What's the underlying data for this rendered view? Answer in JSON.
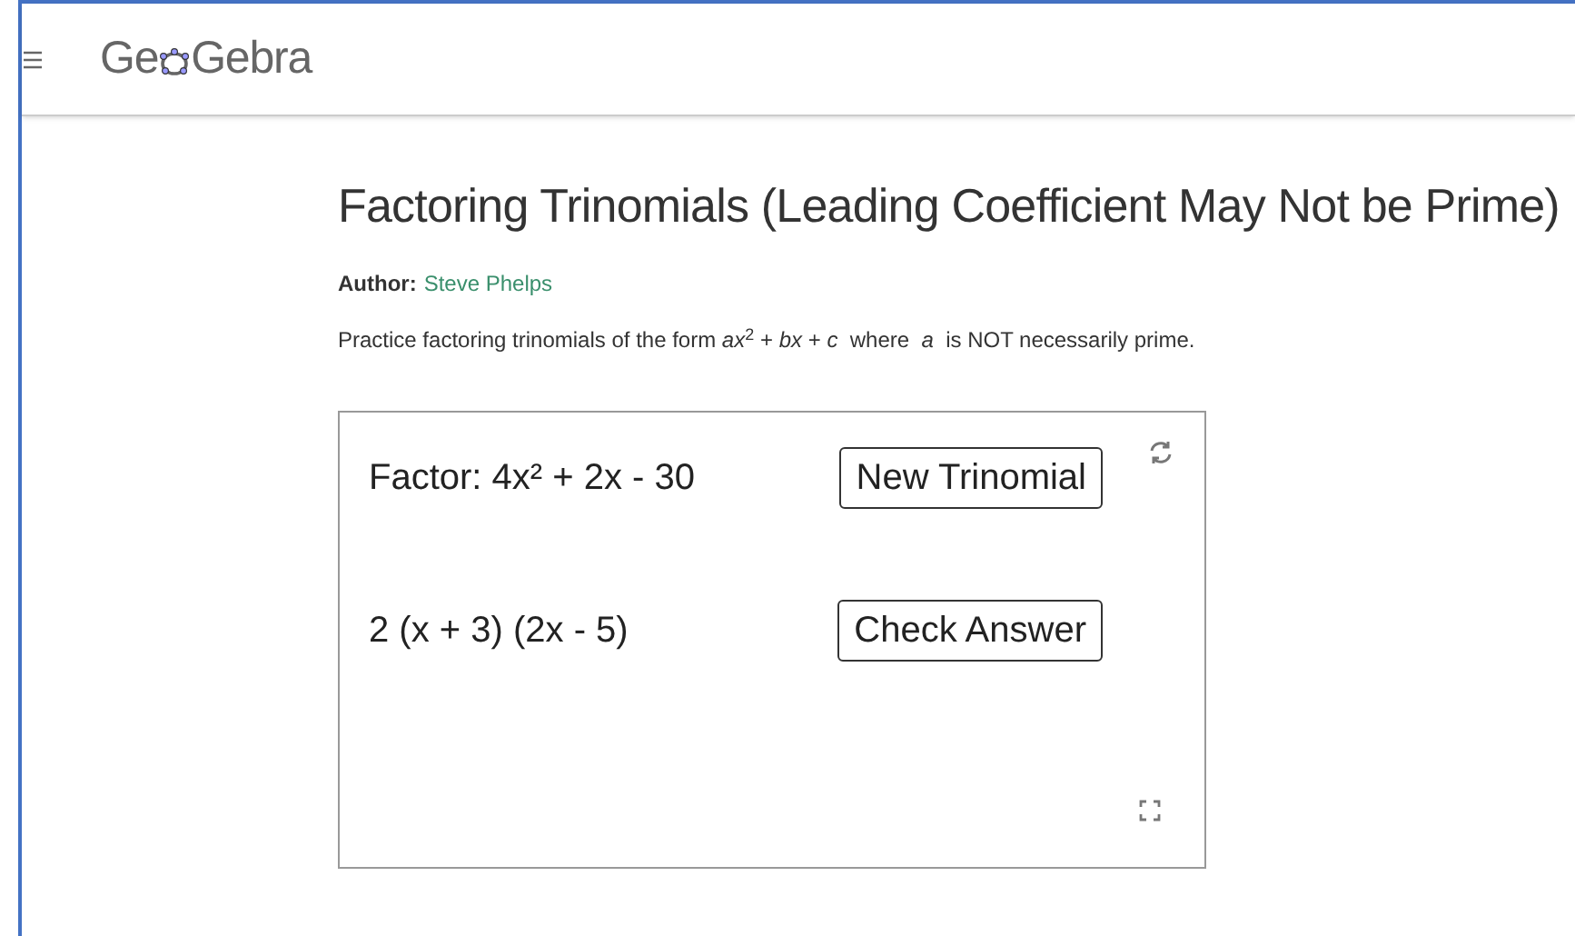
{
  "header": {
    "logo_start": "Ge",
    "logo_end": "Gebra"
  },
  "title": "Factoring Trinomials (Leading Coefficient May Not be Prime)",
  "author": {
    "label": "Author:",
    "name": "Steve Phelps"
  },
  "description": "Practice factoring trinomials of the form *ax*$^{2}$ + *bx* + *c*  where  *a*  is NOT necessarily prime.",
  "applet": {
    "rows": [
      {
        "text": "Factor: 4x² + 2x - 30",
        "button": "New Trinomial"
      },
      {
        "text": "2 (x + 3) (2x - 5)",
        "button": "Check Answer"
      }
    ]
  }
}
